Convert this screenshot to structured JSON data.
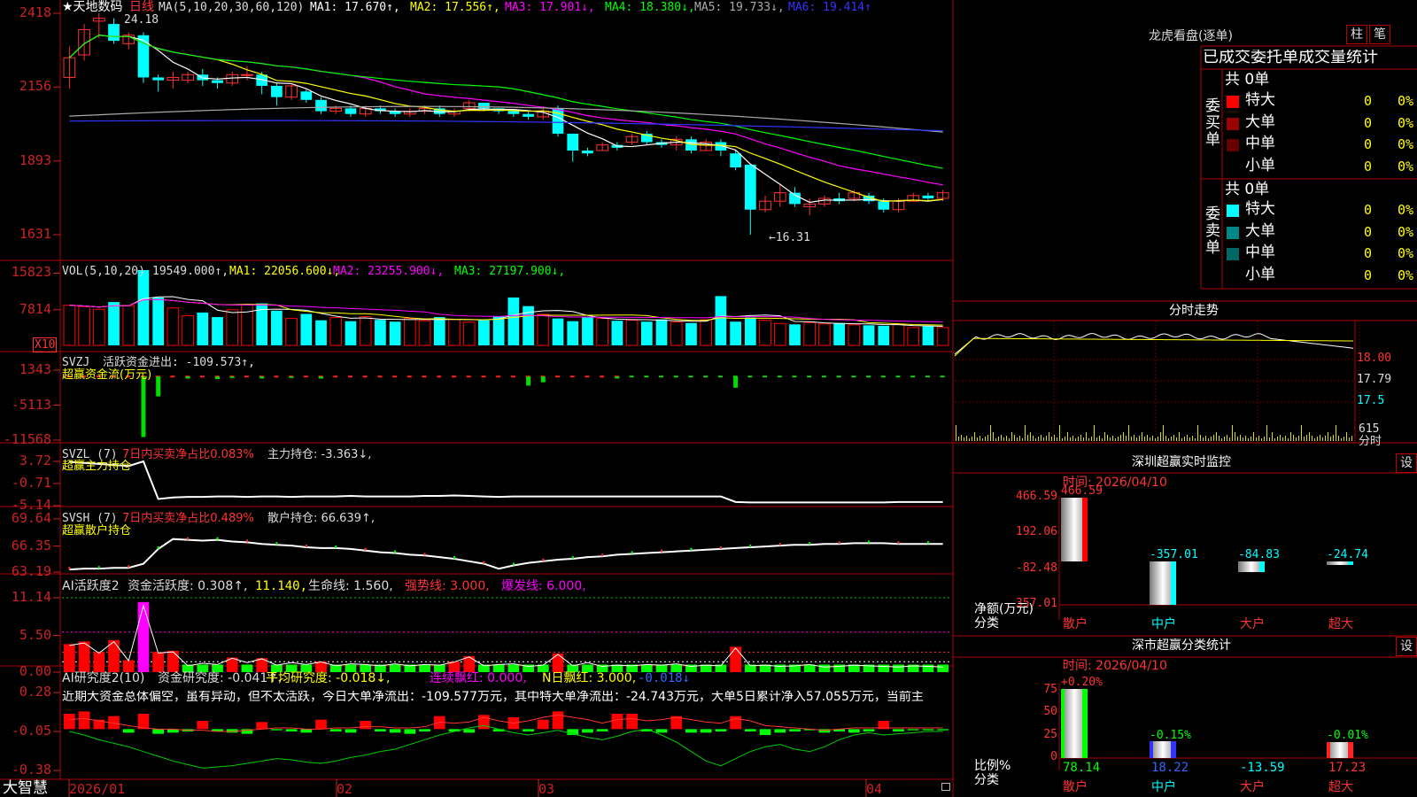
{
  "colors": {
    "up": "#ff3333",
    "down": "#00ffff",
    "vol_up": "#ff0000",
    "axis_red": "#cc2222",
    "ma1": "#ffffff",
    "ma2": "#ffff00",
    "ma3": "#ff00ff",
    "ma4": "#00ff00",
    "ma5": "#aaaaaa",
    "ma6": "#3333ff"
  },
  "stock": {
    "name": "★天地数码",
    "period": "日线"
  },
  "price_panel": {
    "legend_prefix": "MA(5,10,20,30,60,120)",
    "ma_labels": [
      "MA1: 17.670↑,",
      "MA2: 17.556↑,",
      "MA3: 17.901↓,",
      "MA4: 18.380↓,",
      "MA5: 19.733↓,",
      "MA6: 19.414↑"
    ],
    "yticks": [
      "2418",
      "2156",
      "1893",
      "1631"
    ],
    "high_label": "24.18",
    "low_label": "←16.31"
  },
  "vol_panel": {
    "legend": "VOL(5,10,20)",
    "vol": "19549.000↑,",
    "ma1": "MA1: 22056.600↓,",
    "ma2": "MA2: 23255.900↓,",
    "ma3": "MA3: 27197.900↓,",
    "yticks": [
      "15823",
      "7814"
    ],
    "unit": "X10"
  },
  "svzj_panel": {
    "name": "SVZJ",
    "l1": "活跃资金进出: -109.573↑,",
    "l2": "超赢资金流(万元)",
    "yticks": [
      "1343",
      "-5113",
      "-11568"
    ]
  },
  "svzl_panel": {
    "name": "SVZL (7)",
    "l1": "7日内买卖净占比0.083%",
    "l2": "主力持仓: -3.363↓,",
    "l3": "超赢主力持仓",
    "yticks": [
      "3.72",
      "-0.71",
      "-5.14"
    ]
  },
  "svsh_panel": {
    "name": "SVSH (7)",
    "l1": "7日内买卖净占比0.489%",
    "l2": "散户持仓: 66.639↑,",
    "l3": "超赢散户持仓",
    "yticks": [
      "69.64",
      "66.35",
      "63.19"
    ]
  },
  "ai1_panel": {
    "name": "AI活跃度2",
    "l1": "资金活跃度: 0.308↑,",
    "l2": "11.140,",
    "l3": "生命线: 1.560,",
    "l4": "强势线: 3.000,",
    "l5": "爆发线: 6.000,",
    "yticks": [
      "11.14",
      "5.50",
      "0.00"
    ]
  },
  "ai2_panel": {
    "name": "AI研究度2(10)",
    "l1": "资金研究度: -0.041↑,",
    "l2": "平均研究度: -0.018↓,",
    "l3": "连续飘红: 0.000,",
    "l4": "N日飘红: 3.000,",
    "l5": "-0.018↓",
    "commentary": "近期大资金总体偏空，虽有异动，但不太活跃，今日大单净流出：-109.577万元，其中特大单净流出：-24.743万元，大单5日累计净入57.055万元，当前主",
    "yticks": [
      "0.28",
      "-0.05",
      "-0.38"
    ]
  },
  "bottom_bar": {
    "logo": "大智慧",
    "dates": [
      "2026/01",
      "02",
      "03",
      "04"
    ]
  },
  "right_panel": {
    "lhb_title": "龙虎看盘(逐单)",
    "btn_zhu": "柱",
    "btn_bi": "笔",
    "table_header": "已成交委托单成交量统计",
    "buy_side": "委买单",
    "sell_side": "委卖单",
    "buy_total": "共 0单",
    "sell_total": "共 0单",
    "buy_rows": [
      {
        "label": "特大",
        "count": "0",
        "pct": "0%",
        "color": "#ff0000"
      },
      {
        "label": "大单",
        "count": "0",
        "pct": "0%",
        "color": "#990000"
      },
      {
        "label": "中单",
        "count": "0",
        "pct": "0%",
        "color": "#660000"
      },
      {
        "label": "小单",
        "count": "0",
        "pct": "0%",
        "color": ""
      }
    ],
    "sell_rows": [
      {
        "label": "特大",
        "count": "0",
        "pct": "0%",
        "color": "#00ffff"
      },
      {
        "label": "大单",
        "count": "0",
        "pct": "0%",
        "color": "#008888"
      },
      {
        "label": "中单",
        "count": "0",
        "pct": "0%",
        "color": "#006666"
      },
      {
        "label": "小单",
        "count": "0",
        "pct": "0%",
        "color": ""
      }
    ],
    "fenshi_title": "分时走势",
    "fenshi_yticks": [
      "18.00",
      "17.79",
      "17.5"
    ],
    "fenshi_vol": "615",
    "fenshi_unit": "分时",
    "sz_title": "深圳超赢实时监控",
    "btn_set": "设",
    "sz_time": "时间: 2026/04/10",
    "sz_yticks": [
      "466.59",
      "192.06",
      "-82.48",
      "-357.01"
    ],
    "sz_ylabel1": "净额(万元)",
    "sz_ylabel2": "分类",
    "sz_cats": [
      "散户",
      "中户",
      "大户",
      "超大"
    ],
    "sz_values": [
      "466.59",
      "-357.01",
      "-84.83",
      "-24.74"
    ],
    "ss_title": "深市超赢分类统计",
    "ss_time": "时间: 2026/04/10",
    "ss_yticks": [
      "75",
      "50",
      "25",
      "0"
    ],
    "ss_ylabel1": "比例%",
    "ss_ylabel2": "分类",
    "ss_top": [
      "+0.20%",
      "-0.15%",
      "",
      "-0.01%"
    ],
    "ss_bottom": [
      "78.14",
      "18.22",
      "-13.59",
      "17.23"
    ],
    "ss_cats": [
      "散户",
      "中户",
      "大户",
      "超大"
    ]
  },
  "chart_data": [
    {
      "type": "candlestick",
      "title": "★天地数码 日线",
      "series": [
        {
          "name": "price"
        }
      ],
      "ylim": [
        16.31,
        24.18
      ],
      "candles": [
        [
          21.9,
          22.6,
          21.5,
          23.0
        ],
        [
          22.7,
          23.6,
          22.5,
          23.8
        ],
        [
          23.9,
          24.0,
          23.3,
          24.18
        ],
        [
          23.8,
          23.2,
          23.1,
          24.0
        ],
        [
          23.1,
          23.4,
          22.9,
          23.5
        ],
        [
          23.4,
          21.9,
          21.7,
          23.5
        ],
        [
          21.9,
          21.8,
          21.4,
          22.0
        ],
        [
          21.8,
          21.9,
          21.5,
          22.1
        ],
        [
          21.8,
          22.0,
          21.7,
          22.1
        ],
        [
          22.0,
          21.8,
          21.6,
          22.2
        ],
        [
          21.8,
          21.7,
          21.5,
          21.9
        ],
        [
          21.7,
          22.0,
          21.6,
          22.1
        ],
        [
          22.0,
          22.0,
          21.8,
          22.3
        ],
        [
          22.0,
          21.6,
          21.3,
          22.1
        ],
        [
          21.6,
          21.2,
          20.9,
          21.7
        ],
        [
          21.2,
          21.6,
          21.1,
          21.7
        ],
        [
          21.4,
          21.1,
          21.0,
          21.5
        ],
        [
          21.1,
          20.7,
          20.6,
          21.2
        ],
        [
          20.7,
          20.8,
          20.6,
          20.9
        ],
        [
          20.8,
          20.6,
          20.5,
          20.9
        ],
        [
          20.6,
          20.8,
          20.5,
          20.9
        ],
        [
          20.8,
          20.7,
          20.6,
          20.9
        ],
        [
          20.7,
          20.6,
          20.5,
          20.8
        ],
        [
          20.6,
          20.7,
          20.5,
          20.8
        ],
        [
          20.7,
          20.8,
          20.6,
          20.9
        ],
        [
          20.8,
          20.6,
          20.5,
          20.9
        ],
        [
          20.6,
          20.7,
          20.5,
          20.8
        ],
        [
          20.8,
          21.0,
          20.7,
          21.1
        ],
        [
          21.0,
          20.8,
          20.7,
          21.0
        ],
        [
          20.8,
          20.7,
          20.6,
          20.8
        ],
        [
          20.7,
          20.6,
          20.5,
          20.7
        ],
        [
          20.6,
          20.5,
          20.4,
          20.7
        ],
        [
          20.5,
          20.7,
          20.4,
          20.8
        ],
        [
          20.8,
          19.9,
          19.8,
          20.9
        ],
        [
          19.9,
          19.3,
          18.9,
          19.9
        ],
        [
          19.3,
          19.2,
          19.1,
          19.4
        ],
        [
          19.3,
          19.5,
          19.3,
          19.6
        ],
        [
          19.5,
          19.4,
          19.3,
          19.6
        ],
        [
          19.6,
          19.8,
          19.5,
          19.9
        ],
        [
          19.9,
          19.6,
          19.5,
          20.0
        ],
        [
          19.6,
          19.5,
          19.4,
          19.7
        ],
        [
          19.5,
          19.7,
          19.3,
          19.8
        ],
        [
          19.7,
          19.3,
          19.2,
          19.8
        ],
        [
          19.3,
          19.6,
          19.3,
          19.7
        ],
        [
          19.6,
          19.3,
          19.1,
          19.7
        ],
        [
          19.2,
          18.7,
          18.6,
          19.3
        ],
        [
          18.8,
          17.2,
          16.31,
          18.8
        ],
        [
          17.2,
          17.5,
          17.1,
          17.7
        ],
        [
          17.5,
          17.8,
          17.3,
          18.1
        ],
        [
          17.8,
          17.4,
          17.3,
          18.0
        ],
        [
          17.3,
          17.4,
          17.0,
          17.6
        ],
        [
          17.4,
          17.6,
          17.3,
          17.7
        ],
        [
          17.6,
          17.5,
          17.4,
          17.8
        ],
        [
          17.6,
          17.8,
          17.5,
          17.9
        ],
        [
          17.7,
          17.5,
          17.4,
          17.8
        ],
        [
          17.5,
          17.2,
          17.1,
          17.6
        ],
        [
          17.2,
          17.5,
          17.1,
          17.6
        ],
        [
          17.5,
          17.7,
          17.5,
          17.8
        ],
        [
          17.7,
          17.6,
          17.5,
          17.8
        ],
        [
          17.6,
          17.8,
          17.5,
          17.9
        ]
      ]
    },
    {
      "type": "bar",
      "title": "VOL(5,10,20)",
      "values": [
        8800,
        8500,
        7900,
        9500,
        8700,
        16500,
        10500,
        8200,
        6500,
        7200,
        6200,
        7800,
        8900,
        9200,
        7600,
        5900,
        6900,
        5500,
        6100,
        5300,
        6300,
        5600,
        5200,
        5900,
        5400,
        6200,
        5700,
        5100,
        5500,
        6400,
        10500,
        8600,
        6800,
        5900,
        5300,
        6200,
        5900,
        5400,
        5500,
        5200,
        5700,
        5100,
        4900,
        5600,
        10800,
        5200,
        6100,
        5500,
        4800,
        4600,
        5000,
        4700,
        4900,
        4500,
        4400,
        4300,
        4600,
        3900,
        4200,
        3900
      ]
    },
    {
      "type": "bar",
      "title": "SVZJ",
      "values": [
        0,
        0,
        0,
        0,
        0,
        -11000,
        -3500,
        0,
        -200,
        0,
        -300,
        -100,
        0,
        -200,
        0,
        -100,
        0,
        -200,
        0,
        0,
        0,
        0,
        0,
        0,
        0,
        0,
        0,
        0,
        0,
        0,
        0,
        -1500,
        -900,
        0,
        0,
        0,
        0,
        -200,
        0,
        0,
        0,
        0,
        0,
        0,
        0,
        -1900,
        0,
        0,
        0,
        0,
        0,
        0,
        0,
        0,
        0,
        0,
        0,
        0,
        0,
        0
      ]
    },
    {
      "type": "line",
      "title": "SVZL (7)",
      "values": [
        3.6,
        3.4,
        3.2,
        3.0,
        2.8,
        3.72,
        -3.8,
        -3.5,
        -3.4,
        -3.4,
        -3.3,
        -3.3,
        -3.4,
        -3.3,
        -3.3,
        -3.4,
        -3.3,
        -3.3,
        -3.3,
        -3.2,
        -3.3,
        -3.3,
        -3.3,
        -3.3,
        -3.2,
        -3.2,
        -3.1,
        -3.2,
        -3.3,
        -3.4,
        -3.3,
        -3.3,
        -3.3,
        -3.3,
        -3.3,
        -3.3,
        -3.3,
        -3.3,
        -3.3,
        -3.3,
        -3.3,
        -3.3,
        -3.3,
        -3.3,
        -3.3,
        -4.4,
        -4.5,
        -4.5,
        -4.5,
        -4.5,
        -4.5,
        -4.5,
        -4.5,
        -4.5,
        -4.5,
        -4.5,
        -4.4,
        -4.4,
        -4.4,
        -4.4
      ]
    },
    {
      "type": "line",
      "title": "SVSH (7)",
      "values": [
        63.5,
        63.6,
        63.6,
        63.7,
        63.7,
        64.2,
        66.0,
        67.2,
        67.1,
        67.0,
        67.1,
        66.9,
        66.8,
        66.6,
        66.5,
        66.4,
        66.2,
        66.1,
        66.1,
        66.0,
        65.8,
        65.6,
        65.5,
        65.3,
        65.2,
        65.0,
        64.8,
        64.5,
        64.2,
        63.6,
        64.0,
        64.3,
        64.5,
        64.7,
        64.8,
        65.0,
        65.1,
        65.3,
        65.4,
        65.5,
        65.6,
        65.7,
        65.8,
        65.9,
        66.0,
        66.1,
        66.2,
        66.3,
        66.4,
        66.5,
        66.5,
        66.6,
        66.6,
        66.7,
        66.7,
        66.7,
        66.6,
        66.6,
        66.6,
        66.6
      ]
    },
    {
      "type": "bar",
      "title": "AI活跃度2",
      "values": [
        4.2,
        4.6,
        3.0,
        4.8,
        1.8,
        10.5,
        3.0,
        3.2,
        1.0,
        1.4,
        1.2,
        2.2,
        1.5,
        2.1,
        1.1,
        1.5,
        1.2,
        1.6,
        1.0,
        1.3,
        1.2,
        1.0,
        1.3,
        1.0,
        1.2,
        1.1,
        1.6,
        2.4,
        1.0,
        1.2,
        1.3,
        0.9,
        1.1,
        2.8,
        1.0,
        1.5,
        0.9,
        1.1,
        1.0,
        1.2,
        1.1,
        1.3,
        0.9,
        1.1,
        1.0,
        3.8,
        1.0,
        1.1,
        0.9,
        1.0,
        1.2,
        0.8,
        0.9,
        1.1,
        1.0,
        0.9,
        0.8,
        1.0,
        0.9,
        0.8
      ]
    },
    {
      "type": "bar",
      "title": "AI研究度2(10)",
      "values": [
        0.1,
        0.12,
        0.05,
        0.08,
        -0.06,
        0.1,
        -0.07,
        -0.06,
        -0.05,
        0.04,
        -0.05,
        -0.06,
        -0.07,
        0.03,
        -0.04,
        -0.05,
        -0.06,
        0.05,
        -0.05,
        -0.06,
        0.04,
        -0.05,
        -0.06,
        -0.07,
        -0.05,
        0.08,
        -0.05,
        -0.06,
        0.09,
        -0.05,
        0.07,
        -0.05,
        0.05,
        0.12,
        -0.08,
        -0.06,
        -0.05,
        0.1,
        0.1,
        -0.05,
        -0.06,
        0.08,
        -0.06,
        -0.06,
        -0.05,
        0.08,
        -0.05,
        -0.08,
        -0.06,
        -0.05,
        -0.04,
        -0.06,
        -0.05,
        -0.06,
        -0.05,
        0.04,
        -0.05,
        -0.04,
        -0.04,
        -0.04
      ]
    }
  ]
}
